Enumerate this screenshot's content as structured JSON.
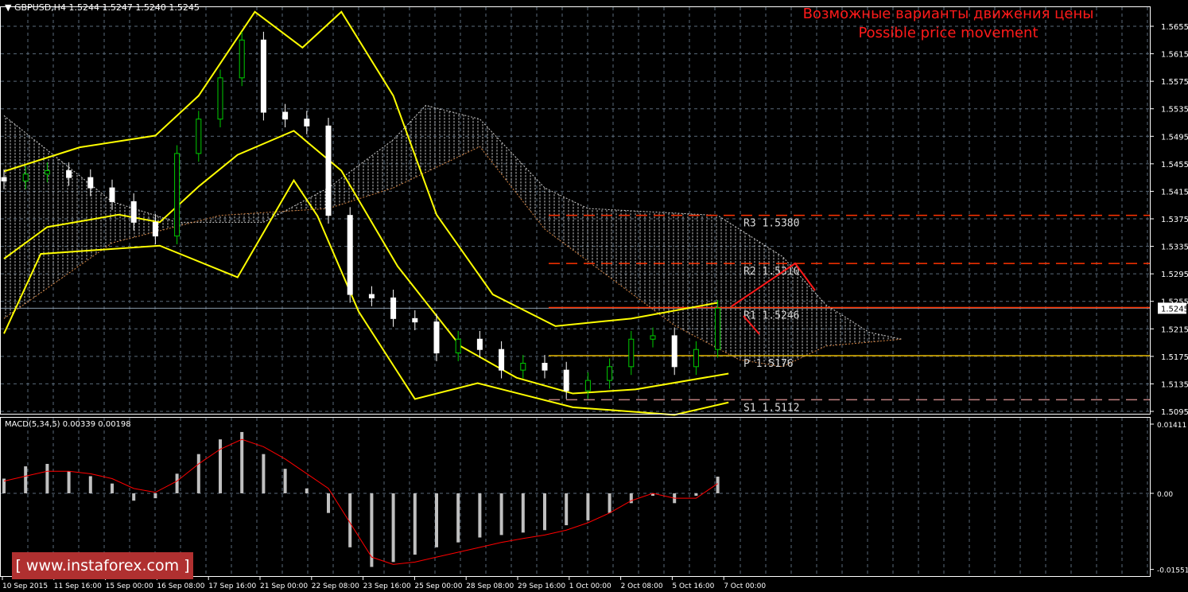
{
  "header": {
    "symbol": "GBPUSD,H4",
    "ohlc": "1.5244 1.5247 1.5240 1.5245"
  },
  "title": {
    "line1": "Возможные варианты движения цены",
    "line2": "Possible price movement"
  },
  "watermark": {
    "left": "[",
    "text": "www.instaforex.com",
    "right": "]"
  },
  "macd_header": "MACD(5,34,5) 0.00339 0.00198",
  "colors": {
    "bg": "#000000",
    "bands": "#ffff00",
    "pivot": "#ff3300",
    "pp": "#e6b800",
    "s1": "#c08080",
    "arrow": "#ff1a1a",
    "macd_hist": "#c0c0c0",
    "macd_signal": "#ff0000",
    "grid": "#5a6a7a"
  },
  "chart_data": [
    {
      "type": "line",
      "title": "GBPUSD,H4",
      "x_tick_labels": [
        "10 Sep 2015",
        "11 Sep 16:00",
        "15 Sep 00:00",
        "16 Sep 08:00",
        "17 Sep 16:00",
        "21 Sep 00:00",
        "22 Sep 08:00",
        "23 Sep 16:00",
        "25 Sep 00:00",
        "28 Sep 08:00",
        "29 Sep 16:00",
        "1 Oct 00:00",
        "2 Oct 08:00",
        "5 Oct 16:00",
        "7 Oct 00:00"
      ],
      "y_tick_labels": [
        "1.5655",
        "1.5615",
        "1.5575",
        "1.5535",
        "1.5495",
        "1.5455",
        "1.5415",
        "1.5375",
        "1.5335",
        "1.5295",
        "1.5255",
        "1.5215",
        "1.5175",
        "1.5135",
        "1.5095"
      ],
      "ylim": [
        1.5085,
        1.569
      ],
      "current_price": "1.5245",
      "closes": [
        1.543,
        1.544,
        1.5445,
        1.5435,
        1.542,
        1.54,
        1.537,
        1.535,
        1.547,
        1.552,
        1.558,
        1.5635,
        1.553,
        1.552,
        1.551,
        1.538,
        1.5265,
        1.526,
        1.523,
        1.5225,
        1.518,
        1.52,
        1.5185,
        1.5155,
        1.5165,
        1.5155,
        1.5125,
        1.514,
        1.516,
        1.52,
        1.5205,
        1.516,
        1.5185,
        1.5245
      ],
      "bands": {
        "upper": [
          [
            0,
            1.5444
          ],
          [
            3.5,
            1.5479
          ],
          [
            7,
            1.5496
          ],
          [
            9,
            1.5554
          ],
          [
            11.6,
            1.5676
          ],
          [
            13.8,
            1.5624
          ],
          [
            15.6,
            1.5676
          ],
          [
            18,
            1.5554
          ],
          [
            20,
            1.5381
          ],
          [
            22.6,
            1.5265
          ],
          [
            25.5,
            1.5219
          ],
          [
            29,
            1.523
          ],
          [
            33,
            1.5253
          ]
        ],
        "middle": [
          [
            0,
            1.5317
          ],
          [
            2,
            1.5363
          ],
          [
            5.3,
            1.5381
          ],
          [
            7.2,
            1.537
          ],
          [
            9,
            1.5422
          ],
          [
            10.8,
            1.5468
          ],
          [
            13.4,
            1.5503
          ],
          [
            15.6,
            1.5445
          ],
          [
            18.2,
            1.5306
          ],
          [
            21.1,
            1.519
          ],
          [
            23.7,
            1.5144
          ],
          [
            26.3,
            1.5121
          ],
          [
            29.2,
            1.5127
          ],
          [
            33.5,
            1.515
          ]
        ],
        "lower": [
          [
            0,
            1.5208
          ],
          [
            1.7,
            1.5324
          ],
          [
            7.2,
            1.5336
          ],
          [
            10.8,
            1.529
          ],
          [
            13.4,
            1.5431
          ],
          [
            14.5,
            1.5379
          ],
          [
            16.4,
            1.524
          ],
          [
            19,
            1.5113
          ],
          [
            21.9,
            1.5136
          ],
          [
            26.3,
            1.5101
          ],
          [
            31,
            1.509
          ],
          [
            33.5,
            1.5108
          ]
        ]
      },
      "cloud": {
        "span_a": [
          [
            0,
            1.5525
          ],
          [
            5,
            1.54
          ],
          [
            8,
            1.537
          ],
          [
            12,
            1.537
          ],
          [
            15,
            1.542
          ],
          [
            18,
            1.549
          ],
          [
            19.5,
            1.554
          ],
          [
            22,
            1.552
          ],
          [
            25,
            1.542
          ],
          [
            27,
            1.539
          ],
          [
            33,
            1.538
          ],
          [
            36,
            1.532
          ],
          [
            38,
            1.525
          ],
          [
            40,
            1.521
          ],
          [
            41.5,
            1.52
          ]
        ],
        "span_b": [
          [
            0,
            1.523
          ],
          [
            5,
            1.534
          ],
          [
            10,
            1.538
          ],
          [
            15,
            1.539
          ],
          [
            18,
            1.542
          ],
          [
            22,
            1.548
          ],
          [
            25,
            1.536
          ],
          [
            28,
            1.529
          ],
          [
            31,
            1.522
          ],
          [
            34,
            1.517
          ],
          [
            36,
            1.516
          ],
          [
            38,
            1.519
          ],
          [
            41.5,
            1.52
          ]
        ]
      },
      "pivots": [
        {
          "name": "R3",
          "value": 1.538,
          "label": "R3  1.5380"
        },
        {
          "name": "R2",
          "value": 1.531,
          "label": "R2  1.5310"
        },
        {
          "name": "R1",
          "value": 1.5246,
          "label": "R1  1.5246"
        },
        {
          "name": "P",
          "value": 1.5176,
          "label": "P  1.5176"
        },
        {
          "name": "S1",
          "value": 1.5112,
          "label": "S1  1.5112"
        }
      ]
    },
    {
      "type": "bar",
      "title": "MACD(5,34,5)",
      "y_tick_labels": [
        "0.01411",
        "0.00",
        "-0.01551"
      ],
      "ylim": [
        -0.01551,
        0.01411
      ],
      "histogram": [
        0.003,
        0.0055,
        0.006,
        0.0045,
        0.0035,
        0.002,
        -0.0015,
        -0.001,
        0.004,
        0.008,
        0.011,
        0.0125,
        0.008,
        0.005,
        0.001,
        -0.004,
        -0.011,
        -0.015,
        -0.014,
        -0.0125,
        -0.011,
        -0.01,
        -0.009,
        -0.0085,
        -0.008,
        -0.0075,
        -0.0065,
        -0.0055,
        -0.004,
        -0.002,
        -0.0005,
        -0.002,
        -0.0005,
        0.0034
      ],
      "signal": [
        0.0025,
        0.0035,
        0.0045,
        0.0045,
        0.004,
        0.003,
        0.001,
        0.0002,
        0.0025,
        0.006,
        0.009,
        0.011,
        0.0095,
        0.007,
        0.004,
        0.001,
        -0.006,
        -0.013,
        -0.0145,
        -0.014,
        -0.013,
        -0.012,
        -0.011,
        -0.01,
        -0.0092,
        -0.0085,
        -0.0075,
        -0.006,
        -0.004,
        -0.0015,
        0.0,
        -0.001,
        -0.001,
        0.002
      ]
    }
  ]
}
